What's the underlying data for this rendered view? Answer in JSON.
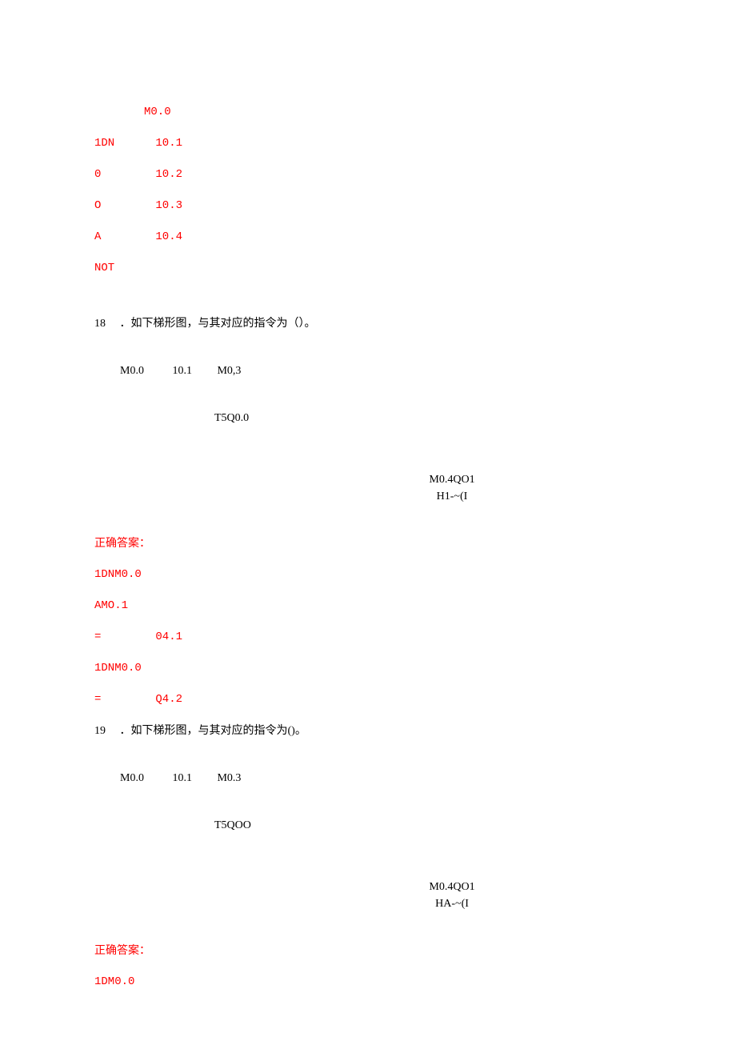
{
  "block1": {
    "l1": "M0.0",
    "l2a": "1DN",
    "l2b": "10.1",
    "l3a": "0",
    "l3b": "10.2",
    "l4a": "O",
    "l4b": "10.3",
    "l5a": "A",
    "l5b": "10.4",
    "l6": "NOT"
  },
  "q18": {
    "num": "18",
    "text": "．如下梯形图，与其对应的指令为（）。",
    "d1a": "M0.0",
    "d1b": "10.1",
    "d1c": "M0,3",
    "d2": "T5Q0.0",
    "d3": "M0.4QO1",
    "d4": "H1-~(I",
    "ans_label": "正确答案：",
    "a1": "1DNM0.0",
    "a2": "AMO.1",
    "a3a": "=",
    "a3b": "04.1",
    "a4": "1DNM0.0",
    "a5a": "=",
    "a5b": "Q4.2"
  },
  "q19": {
    "num": "19",
    "text": "．如下梯形图，与其对应的指令为()。",
    "d1a": "M0.0",
    "d1b": "10.1",
    "d1c": "M0.3",
    "d2": "T5QOO",
    "d3": "M0.4QO1",
    "d4": "HA-~(I",
    "ans_label": "正确答案：",
    "a1": "1DM0.0"
  }
}
